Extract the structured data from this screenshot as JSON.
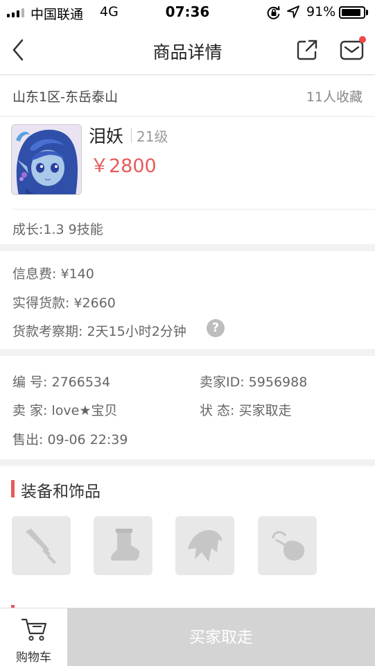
{
  "status_bar": {
    "carrier": "中国联通",
    "network": "4G",
    "time": "07:36",
    "battery_percent": "91%",
    "battery_level": 0.91
  },
  "nav": {
    "title": "商品详情"
  },
  "listing": {
    "server": "山东1区-东岳泰山",
    "favorites": "11人收藏",
    "pet_name": "泪妖",
    "level": "21级",
    "price": "￥2800",
    "growth": "成长:1.3 9技能"
  },
  "fees": {
    "info_fee": "信息费: ¥140",
    "actual_payment": "实得货款: ¥2660",
    "inspection_period": "货款考察期: 2天15小时2分钟",
    "help_icon": "?"
  },
  "details": {
    "serial": "编   号: 2766534",
    "seller_id": "卖家ID: 5956988",
    "seller": "卖   家: love★宝贝",
    "status": "状   态: 买家取走",
    "sold_at": "售出: 09-06 22:39"
  },
  "equipment": {
    "title": "装备和饰品",
    "slots": [
      "weapon-slot-icon",
      "boots-slot-icon",
      "armor-slot-icon",
      "accessory-slot-icon"
    ]
  },
  "bottom": {
    "cart_label": "购物车",
    "buy_label": "买家取走"
  },
  "colors": {
    "accent_red": "#e85a5a",
    "disabled_button": "#d4d4d4"
  }
}
